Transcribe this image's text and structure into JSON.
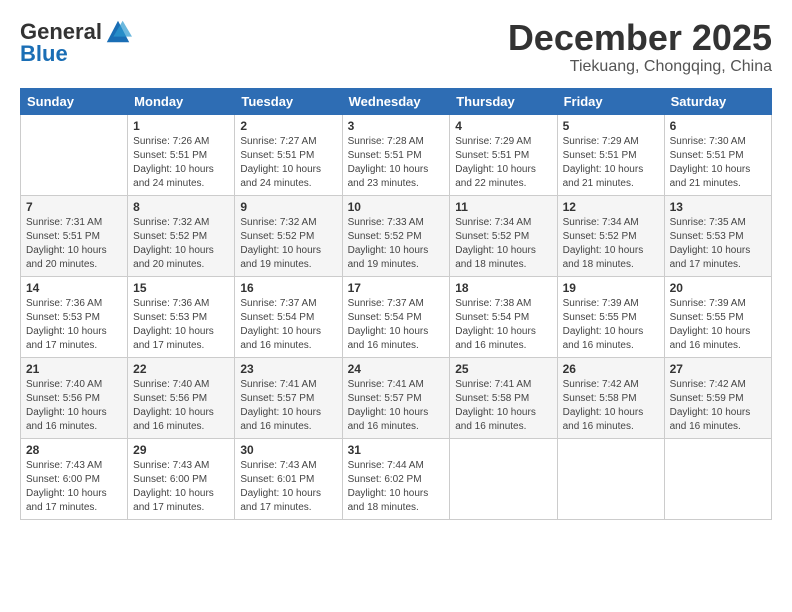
{
  "header": {
    "logo_general": "General",
    "logo_blue": "Blue",
    "month_title": "December 2025",
    "location": "Tiekuang, Chongqing, China"
  },
  "days_of_week": [
    "Sunday",
    "Monday",
    "Tuesday",
    "Wednesday",
    "Thursday",
    "Friday",
    "Saturday"
  ],
  "weeks": [
    [
      {
        "day": "",
        "detail": ""
      },
      {
        "day": "1",
        "detail": "Sunrise: 7:26 AM\nSunset: 5:51 PM\nDaylight: 10 hours\nand 24 minutes."
      },
      {
        "day": "2",
        "detail": "Sunrise: 7:27 AM\nSunset: 5:51 PM\nDaylight: 10 hours\nand 24 minutes."
      },
      {
        "day": "3",
        "detail": "Sunrise: 7:28 AM\nSunset: 5:51 PM\nDaylight: 10 hours\nand 23 minutes."
      },
      {
        "day": "4",
        "detail": "Sunrise: 7:29 AM\nSunset: 5:51 PM\nDaylight: 10 hours\nand 22 minutes."
      },
      {
        "day": "5",
        "detail": "Sunrise: 7:29 AM\nSunset: 5:51 PM\nDaylight: 10 hours\nand 21 minutes."
      },
      {
        "day": "6",
        "detail": "Sunrise: 7:30 AM\nSunset: 5:51 PM\nDaylight: 10 hours\nand 21 minutes."
      }
    ],
    [
      {
        "day": "7",
        "detail": "Sunrise: 7:31 AM\nSunset: 5:51 PM\nDaylight: 10 hours\nand 20 minutes."
      },
      {
        "day": "8",
        "detail": "Sunrise: 7:32 AM\nSunset: 5:52 PM\nDaylight: 10 hours\nand 20 minutes."
      },
      {
        "day": "9",
        "detail": "Sunrise: 7:32 AM\nSunset: 5:52 PM\nDaylight: 10 hours\nand 19 minutes."
      },
      {
        "day": "10",
        "detail": "Sunrise: 7:33 AM\nSunset: 5:52 PM\nDaylight: 10 hours\nand 19 minutes."
      },
      {
        "day": "11",
        "detail": "Sunrise: 7:34 AM\nSunset: 5:52 PM\nDaylight: 10 hours\nand 18 minutes."
      },
      {
        "day": "12",
        "detail": "Sunrise: 7:34 AM\nSunset: 5:52 PM\nDaylight: 10 hours\nand 18 minutes."
      },
      {
        "day": "13",
        "detail": "Sunrise: 7:35 AM\nSunset: 5:53 PM\nDaylight: 10 hours\nand 17 minutes."
      }
    ],
    [
      {
        "day": "14",
        "detail": "Sunrise: 7:36 AM\nSunset: 5:53 PM\nDaylight: 10 hours\nand 17 minutes."
      },
      {
        "day": "15",
        "detail": "Sunrise: 7:36 AM\nSunset: 5:53 PM\nDaylight: 10 hours\nand 17 minutes."
      },
      {
        "day": "16",
        "detail": "Sunrise: 7:37 AM\nSunset: 5:54 PM\nDaylight: 10 hours\nand 16 minutes."
      },
      {
        "day": "17",
        "detail": "Sunrise: 7:37 AM\nSunset: 5:54 PM\nDaylight: 10 hours\nand 16 minutes."
      },
      {
        "day": "18",
        "detail": "Sunrise: 7:38 AM\nSunset: 5:54 PM\nDaylight: 10 hours\nand 16 minutes."
      },
      {
        "day": "19",
        "detail": "Sunrise: 7:39 AM\nSunset: 5:55 PM\nDaylight: 10 hours\nand 16 minutes."
      },
      {
        "day": "20",
        "detail": "Sunrise: 7:39 AM\nSunset: 5:55 PM\nDaylight: 10 hours\nand 16 minutes."
      }
    ],
    [
      {
        "day": "21",
        "detail": "Sunrise: 7:40 AM\nSunset: 5:56 PM\nDaylight: 10 hours\nand 16 minutes."
      },
      {
        "day": "22",
        "detail": "Sunrise: 7:40 AM\nSunset: 5:56 PM\nDaylight: 10 hours\nand 16 minutes."
      },
      {
        "day": "23",
        "detail": "Sunrise: 7:41 AM\nSunset: 5:57 PM\nDaylight: 10 hours\nand 16 minutes."
      },
      {
        "day": "24",
        "detail": "Sunrise: 7:41 AM\nSunset: 5:57 PM\nDaylight: 10 hours\nand 16 minutes."
      },
      {
        "day": "25",
        "detail": "Sunrise: 7:41 AM\nSunset: 5:58 PM\nDaylight: 10 hours\nand 16 minutes."
      },
      {
        "day": "26",
        "detail": "Sunrise: 7:42 AM\nSunset: 5:58 PM\nDaylight: 10 hours\nand 16 minutes."
      },
      {
        "day": "27",
        "detail": "Sunrise: 7:42 AM\nSunset: 5:59 PM\nDaylight: 10 hours\nand 16 minutes."
      }
    ],
    [
      {
        "day": "28",
        "detail": "Sunrise: 7:43 AM\nSunset: 6:00 PM\nDaylight: 10 hours\nand 17 minutes."
      },
      {
        "day": "29",
        "detail": "Sunrise: 7:43 AM\nSunset: 6:00 PM\nDaylight: 10 hours\nand 17 minutes."
      },
      {
        "day": "30",
        "detail": "Sunrise: 7:43 AM\nSunset: 6:01 PM\nDaylight: 10 hours\nand 17 minutes."
      },
      {
        "day": "31",
        "detail": "Sunrise: 7:44 AM\nSunset: 6:02 PM\nDaylight: 10 hours\nand 18 minutes."
      },
      {
        "day": "",
        "detail": ""
      },
      {
        "day": "",
        "detail": ""
      },
      {
        "day": "",
        "detail": ""
      }
    ]
  ]
}
